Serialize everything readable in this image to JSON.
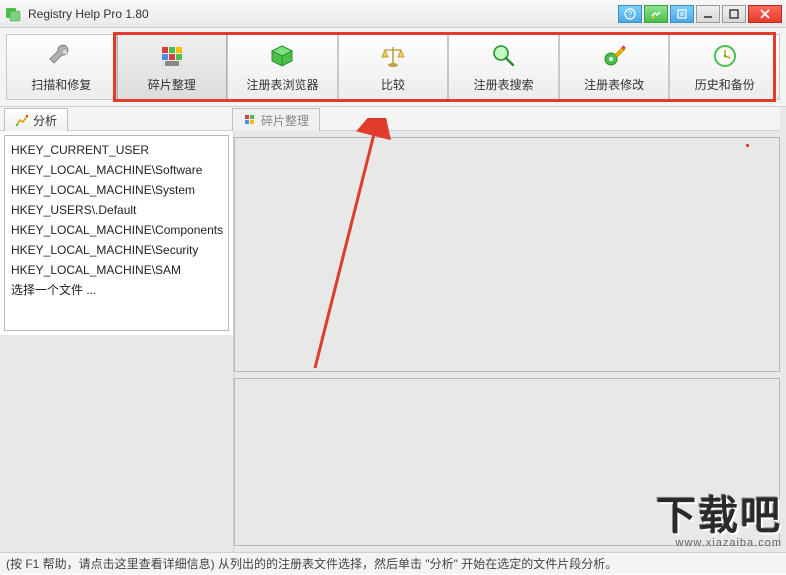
{
  "window": {
    "title": "Registry Help Pro 1.80"
  },
  "toolbar": {
    "items": [
      {
        "label": "扫描和修复"
      },
      {
        "label": "碎片整理"
      },
      {
        "label": "注册表浏览器"
      },
      {
        "label": "比较"
      },
      {
        "label": "注册表搜索"
      },
      {
        "label": "注册表修改"
      },
      {
        "label": "历史和备份"
      }
    ]
  },
  "tabs": {
    "left": {
      "label": "分析"
    },
    "right": {
      "label": "碎片整理"
    }
  },
  "registry_list": {
    "items": [
      "HKEY_CURRENT_USER",
      "HKEY_LOCAL_MACHINE\\Software",
      "HKEY_LOCAL_MACHINE\\System",
      "HKEY_USERS\\.Default",
      "HKEY_LOCAL_MACHINE\\Components",
      "HKEY_LOCAL_MACHINE\\Security",
      "HKEY_LOCAL_MACHINE\\SAM",
      "选择一个文件 ..."
    ]
  },
  "statusbar": {
    "text": "(按 F1 帮助，请点击这里查看详细信息) 从列出的的注册表文件选择，然后单击 \"分析\" 开始在选定的文件片段分析。"
  },
  "watermark": {
    "text": "下载吧",
    "sub": "www.xiazaiba.com"
  }
}
